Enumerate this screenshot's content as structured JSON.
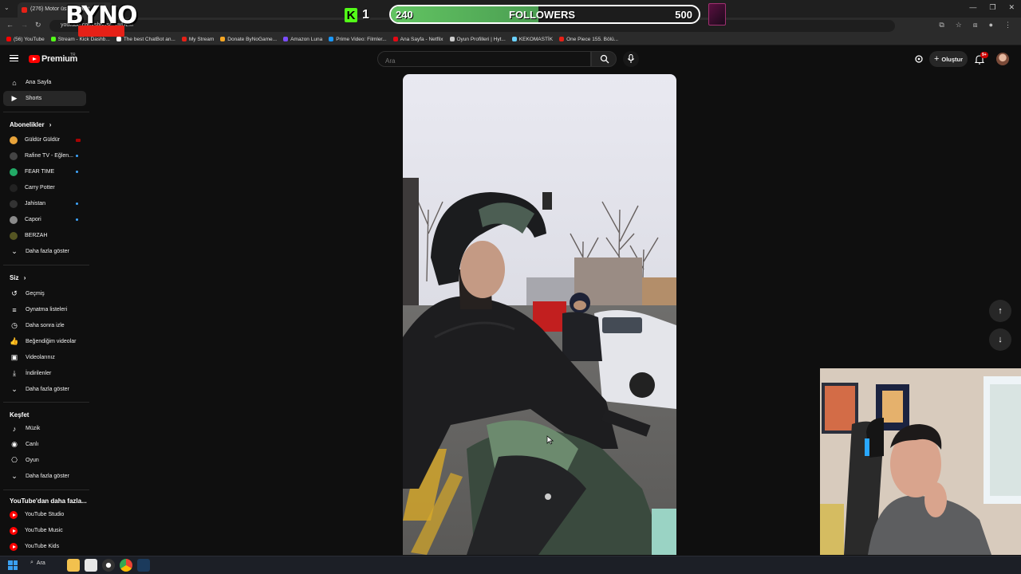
{
  "browser": {
    "tab_title": "(276) Motor üstü sohbet",
    "url": "youtube.com/shorts/...uvULM",
    "bookmarks": [
      {
        "label": "(56) YouTube",
        "color": "#ff0000"
      },
      {
        "label": "Stream - Kick Dashb...",
        "color": "#53fc18"
      },
      {
        "label": "The best ChatBot an...",
        "color": "#ffffff"
      },
      {
        "label": "My Stream",
        "color": "#e62117"
      },
      {
        "label": "Donate ByNoGame...",
        "color": "#f5a623"
      },
      {
        "label": "Amazon Luna",
        "color": "#7b4dff"
      },
      {
        "label": "Prime Video: Filmler...",
        "color": "#1a98ff"
      },
      {
        "label": "Ana Sayfa - Netflix",
        "color": "#e50914"
      },
      {
        "label": "Oyun Profilleri | Hyt...",
        "color": "#cccccc"
      },
      {
        "label": "KEKOMASTİK",
        "color": "#6ad1ff"
      },
      {
        "label": "One Piece 155. Bölü...",
        "color": "#e62117"
      }
    ]
  },
  "header": {
    "logo_text": "Premium",
    "logo_region": "TR",
    "search_placeholder": "Ara",
    "create_label": "Oluştur",
    "notif_count": "9+"
  },
  "sidebar": {
    "main": [
      {
        "label": "Ana Sayfa",
        "icon": "home-icon",
        "glyph": "⌂"
      },
      {
        "label": "Shorts",
        "icon": "shorts-icon",
        "glyph": "▶",
        "active": true
      }
    ],
    "subs_title": "Abonelikler",
    "subs": [
      {
        "label": "Güldür Güldür",
        "color": "#e8a33a",
        "status": "live"
      },
      {
        "label": "Rafine TV - Eğlen...",
        "color": "#444",
        "status": "dot"
      },
      {
        "label": "FEAR TIME",
        "color": "#2a6",
        "status": "dot"
      },
      {
        "label": "Carry Potter",
        "color": "#222",
        "status": ""
      },
      {
        "label": "Jahistan",
        "color": "#333",
        "status": "dot"
      },
      {
        "label": "Capori",
        "color": "#8a8a8a",
        "status": "dot"
      },
      {
        "label": "BERZAH",
        "color": "#552",
        "status": ""
      }
    ],
    "more_label": "Daha fazla göster",
    "you_title": "Siz",
    "you": [
      {
        "label": "Geçmiş",
        "icon": "history-icon",
        "glyph": "↺"
      },
      {
        "label": "Oynatma listeleri",
        "icon": "playlist-icon",
        "glyph": "≡"
      },
      {
        "label": "Daha sonra izle",
        "icon": "clock-icon",
        "glyph": "◷"
      },
      {
        "label": "Beğendiğim videolar",
        "icon": "thumb-up-icon",
        "glyph": "👍"
      },
      {
        "label": "Videolarınız",
        "icon": "your-videos-icon",
        "glyph": "▣"
      },
      {
        "label": "İndirilenler",
        "icon": "download-icon",
        "glyph": "⤓"
      }
    ],
    "explore_title": "Keşfet",
    "explore": [
      {
        "label": "Müzik",
        "icon": "music-icon",
        "glyph": "♪"
      },
      {
        "label": "Canlı",
        "icon": "live-icon",
        "glyph": "◉"
      },
      {
        "label": "Oyun",
        "icon": "gaming-icon",
        "glyph": "⎔"
      }
    ],
    "more_from_title": "YouTube'dan daha fazla...",
    "more_from": [
      {
        "label": "YouTube Studio"
      },
      {
        "label": "YouTube Music"
      },
      {
        "label": "YouTube Kids"
      }
    ]
  },
  "overlay": {
    "brand": "BYNO",
    "kick_icon": "K",
    "kick_viewers": "1",
    "followers_current": "240",
    "followers_label": "FOLLOWERS",
    "followers_goal": "500",
    "followers_progress": 0.48
  },
  "taskbar": {
    "search_label": "Ara"
  }
}
